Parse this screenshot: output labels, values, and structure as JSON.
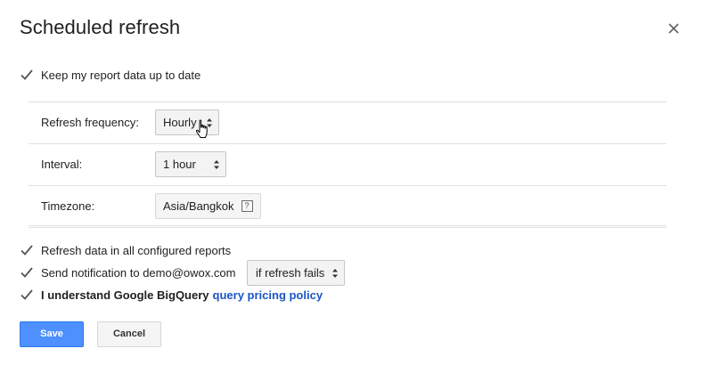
{
  "dialog": {
    "title": "Scheduled refresh",
    "close_icon": "close-icon"
  },
  "keep_up_to_date": {
    "label": "Keep my report data up to date",
    "checked": true
  },
  "settings": {
    "frequency": {
      "label": "Refresh frequency:",
      "value": "Hourly"
    },
    "interval": {
      "label": "Interval:",
      "value": "1 hour"
    },
    "timezone": {
      "label": "Timezone:",
      "value": "Asia/Bangkok",
      "help": "?"
    }
  },
  "options": {
    "refresh_all": {
      "label": "Refresh data in all configured reports",
      "checked": true
    },
    "notification": {
      "label": "Send notification to demo@owox.com",
      "checked": true,
      "condition": "if refresh fails"
    },
    "pricing": {
      "label": "I understand Google BigQuery",
      "link": "query pricing policy",
      "checked": true
    }
  },
  "buttons": {
    "save": "Save",
    "cancel": "Cancel"
  },
  "colors": {
    "primary": "#4d90fe",
    "link": "#1a56c7",
    "divider": "#e0e0e0"
  }
}
